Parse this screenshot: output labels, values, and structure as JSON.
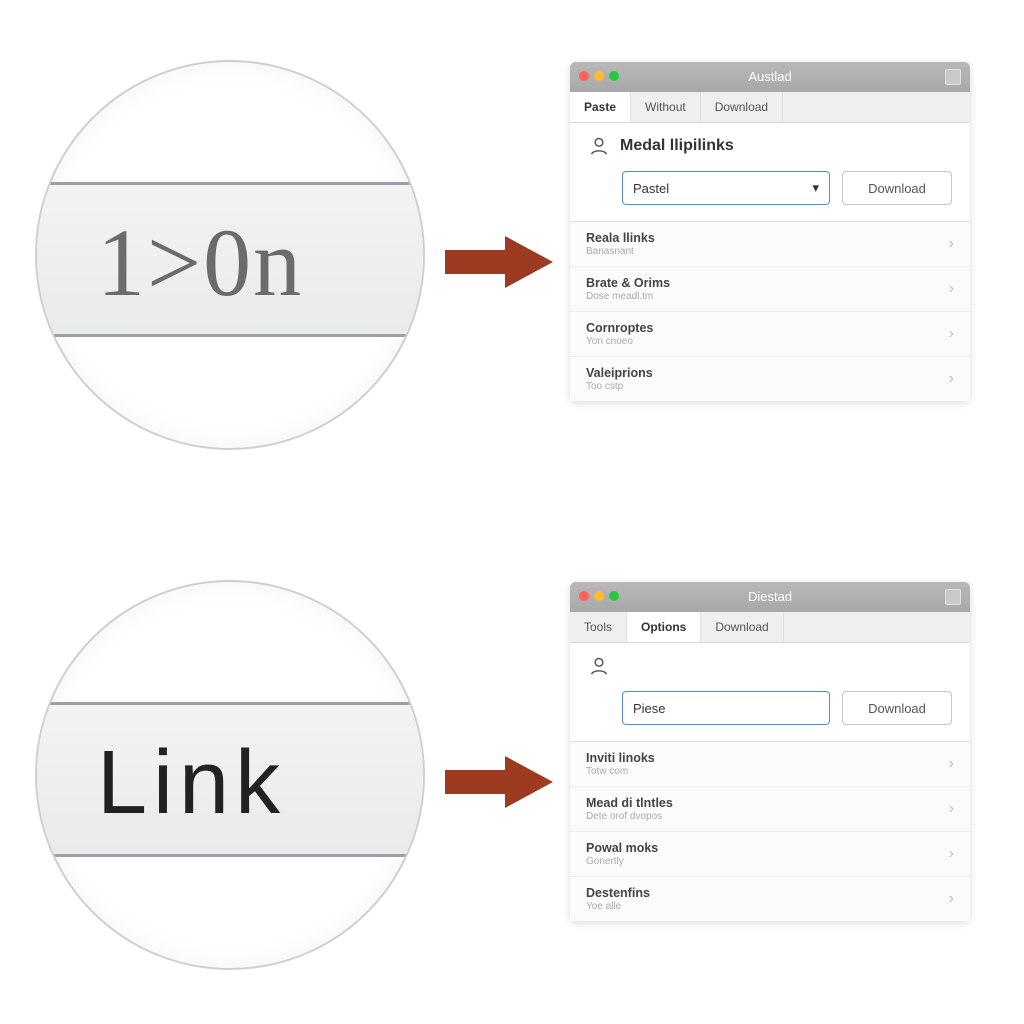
{
  "circles": {
    "top_text": "1>0n",
    "bottom_text": "Link"
  },
  "windows": [
    {
      "title": "Austlad",
      "tabs": [
        "Paste",
        "Without",
        "Download"
      ],
      "active_tab": 0,
      "heading": "Medal llipilinks",
      "select_value": "Pastel",
      "button_label": "Download",
      "items": [
        {
          "title": "Reala llinks",
          "subtitle": "Banasnant"
        },
        {
          "title": "Brate & Orims",
          "subtitle": "Dose meadl.tm"
        },
        {
          "title": "Cornroptes",
          "subtitle": "Yon cnoeo"
        },
        {
          "title": "Valeiprions",
          "subtitle": "Too cstp"
        }
      ]
    },
    {
      "title": "Diestad",
      "tabs": [
        "Tools",
        "Options",
        "Download"
      ],
      "active_tab": 1,
      "heading": "",
      "select_value": "Piese",
      "button_label": "Download",
      "items": [
        {
          "title": "Inviti linoks",
          "subtitle": "Totw com"
        },
        {
          "title": "Mead di tlntles",
          "subtitle": "Dete orof dvopos"
        },
        {
          "title": "Powal moks",
          "subtitle": "Gonertly"
        },
        {
          "title": "Destenfins",
          "subtitle": "Yoe alle"
        }
      ]
    }
  ]
}
